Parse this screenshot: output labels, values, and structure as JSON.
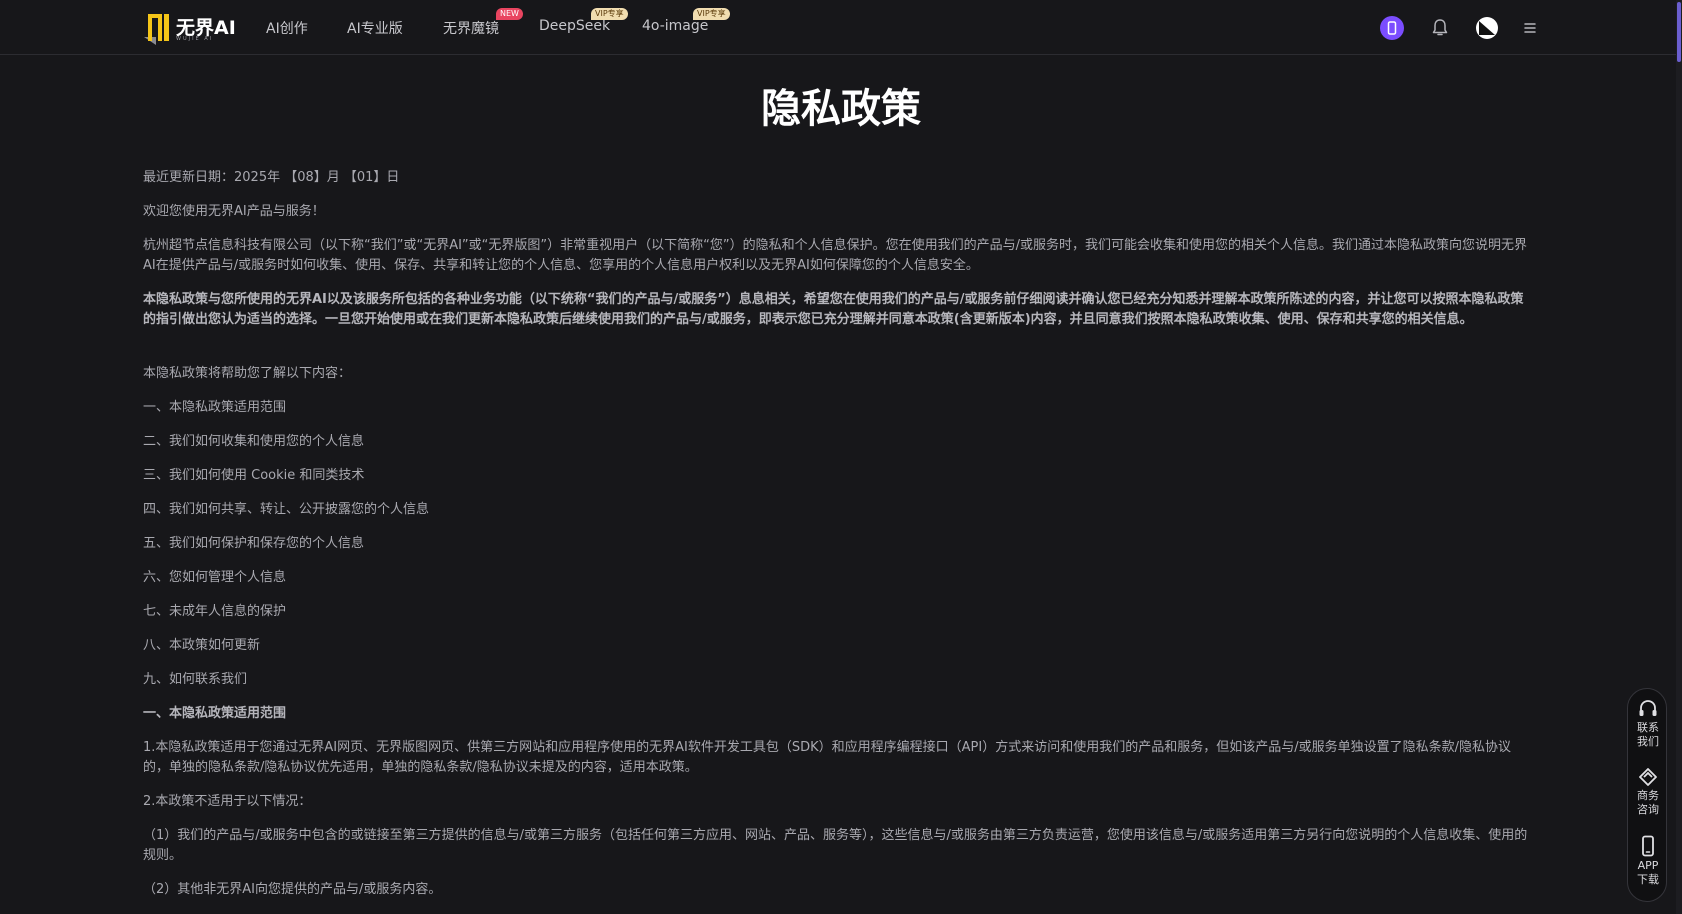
{
  "header": {
    "logo_text": "无界AI",
    "logo_sub": "WUJIE AI",
    "nav": [
      {
        "label": "AI创作"
      },
      {
        "label": "AI专业版"
      },
      {
        "label": "无界魔镜",
        "badge": "NEW"
      },
      {
        "label": "DeepSeek",
        "badge": "VIP专享"
      },
      {
        "label": "4o-image",
        "badge": "VIP专享"
      }
    ]
  },
  "page": {
    "title": "隐私政策",
    "updated": "最近更新日期：2025年 【08】月 【01】日",
    "welcome": "欢迎您使用无界AI产品与服务！",
    "intro": "杭州超节点信息科技有限公司（以下称“我们”或“无界AI”或“无界版图”）非常重视用户（以下简称“您”）的隐私和个人信息保护。您在使用我们的产品与/或服务时，我们可能会收集和使用您的相关个人信息。我们通过本隐私政策向您说明无界AI在提供产品与/或服务时如何收集、使用、保存、共享和转让您的个人信息、您享用的个人信息用户权利以及无界AI如何保障您的个人信息安全。",
    "notice_bold": "本隐私政策与您所使用的无界AI以及该服务所包括的各种业务功能（以下统称“我们的产品与/或服务”）息息相关，希望您在使用我们的产品与/或服务前仔细阅读并确认您已经充分知悉并理解本政策所陈述的内容，并让您可以按照本隐私政策的指引做出您认为适当的选择。一旦您开始使用或在我们更新本隐私政策后继续使用我们的产品与/或服务，即表示您已充分理解并同意本政策(含更新版本)内容，并且同意我们按照本隐私政策收集、使用、保存和共享您的相关信息。",
    "toc_intro": "本隐私政策将帮助您了解以下内容：",
    "toc": [
      "一、本隐私政策适用范围",
      "二、我们如何收集和使用您的个人信息",
      "三、我们如何使用 Cookie 和同类技术",
      "四、我们如何共享、转让、公开披露您的个人信息",
      "五、我们如何保护和保存您的个人信息",
      "六、您如何管理个人信息",
      "七、未成年人信息的保护",
      "八、本政策如何更新",
      "九、如何联系我们"
    ],
    "section1_title": "一、本隐私政策适用范围",
    "section1_p1": "1.本隐私政策适用于您通过无界AI网页、无界版图网页、供第三方网站和应用程序使用的无界AI软件开发工具包（SDK）和应用程序编程接口（API）方式来访问和使用我们的产品和服务，但如该产品与/或服务单独设置了隐私条款/隐私协议的，单独的隐私条款/隐私协议优先适用，单独的隐私条款/隐私协议未提及的内容，适用本政策。",
    "section1_p2": "2.本政策不适用于以下情况：",
    "section1_p3": "（1）我们的产品与/或服务中包含的或链接至第三方提供的信息与/或第三方服务（包括任何第三方应用、网站、产品、服务等），这些信息与/或服务由第三方负责运营，您使用该信息与/或服务适用第三方另行向您说明的个人信息收集、使用的规则。",
    "section1_p4": "（2）其他非无界AI向您提供的产品与/或服务内容。"
  },
  "float_panel": {
    "contact": [
      "联系",
      "我们"
    ],
    "business": [
      "商务",
      "咨询"
    ],
    "app": [
      "APP",
      "下载"
    ]
  }
}
